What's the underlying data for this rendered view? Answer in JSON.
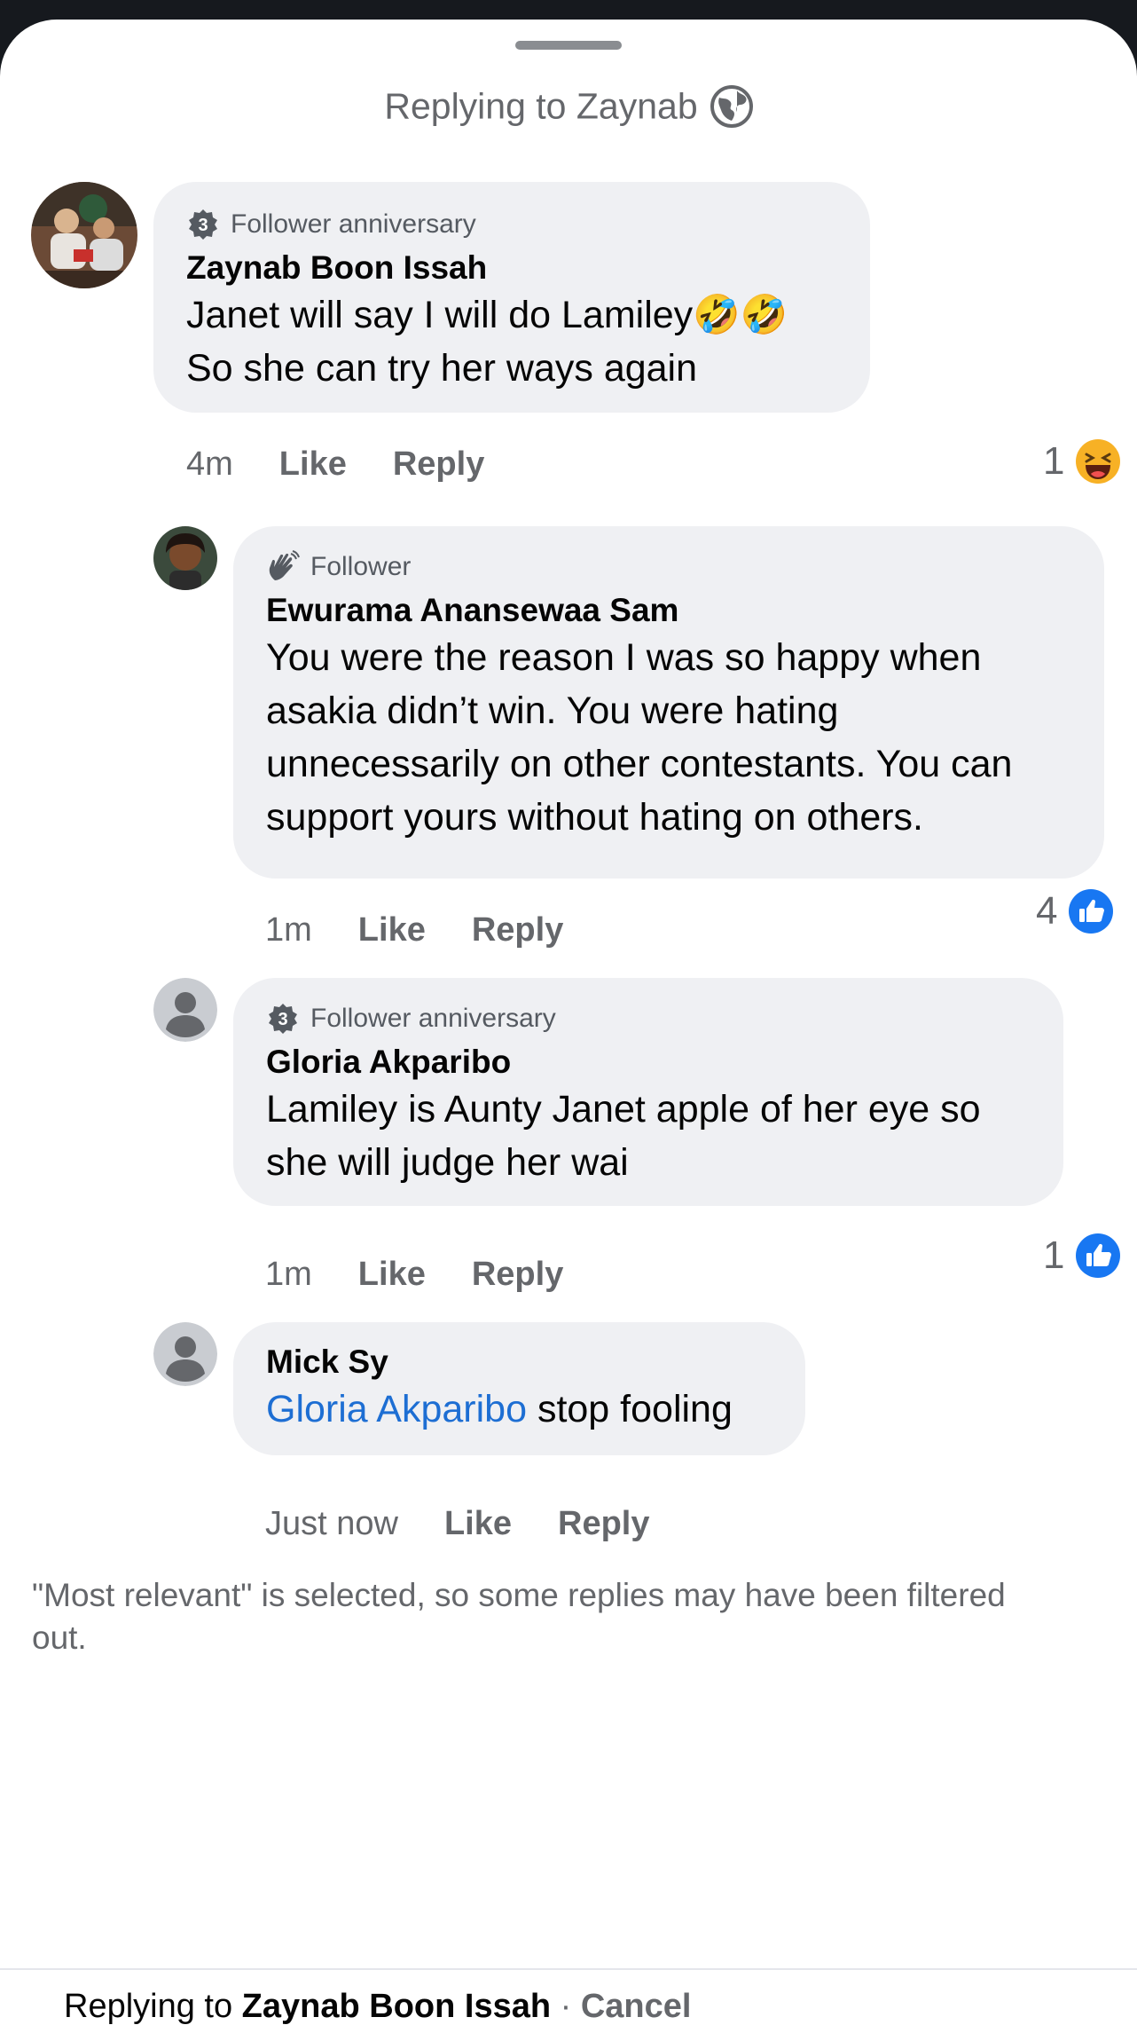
{
  "header": {
    "title": "Replying to Zaynab",
    "audience_icon": "globe-icon"
  },
  "comments": [
    {
      "badge": "Follower anniversary",
      "badge_icon": "anniversary-3-icon",
      "author": "Zaynab Boon Issah",
      "text_line1": "Janet will say I will do Lamiley🤣🤣",
      "text_line2": "So she can try her ways again",
      "time": "4m",
      "like_label": "Like",
      "reply_label": "Reply",
      "reaction_count": "1",
      "reaction_icon": "laughing-face-icon"
    },
    {
      "badge": "Follower",
      "badge_icon": "waving-hand-icon",
      "author": "Ewurama Anansewaa Sam",
      "text_lines": [
        "You were the reason I was so happy when",
        "asakia didn’t win. You were hating",
        "unnecessarily on other contestants. You can",
        "support yours without hating on others."
      ],
      "time": "1m",
      "like_label": "Like",
      "reply_label": "Reply",
      "reaction_count": "4",
      "reaction_icon": "thumbs-up-icon"
    },
    {
      "badge": "Follower anniversary",
      "badge_icon": "anniversary-3-icon",
      "author": "Gloria Akparibo",
      "text_lines": [
        "Lamiley is Aunty Janet apple of her eye so",
        "she will judge her wai"
      ],
      "time": "1m",
      "like_label": "Like",
      "reply_label": "Reply",
      "reaction_count": "1",
      "reaction_icon": "thumbs-up-icon"
    },
    {
      "author": "Mick Sy",
      "mention": "Gloria Akparibo",
      "text": " stop fooling",
      "time": "Just now",
      "like_label": "Like",
      "reply_label": "Reply"
    }
  ],
  "filter_note": "\"Most relevant\" is selected, so some replies may have been filtered out.",
  "footer": {
    "prefix": "Replying to ",
    "name": "Zaynab Boon Issah",
    "separator": " · ",
    "cancel": "Cancel"
  },
  "colors": {
    "bubble": "#eff0f3",
    "mention": "#1d6ed3",
    "like_blue": "#1877f2",
    "secondary_text": "#65676b"
  }
}
